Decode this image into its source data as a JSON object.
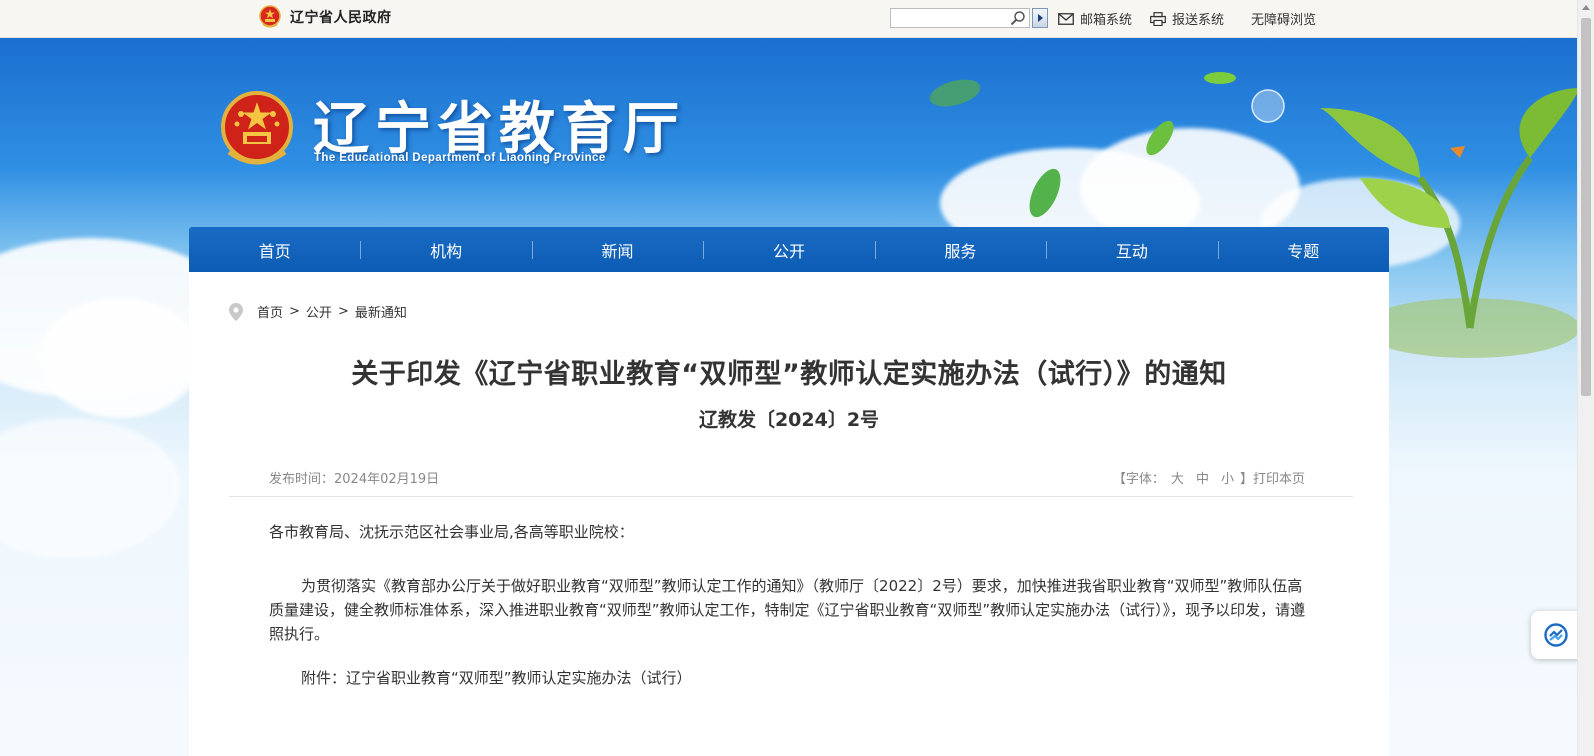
{
  "topbar": {
    "gov_name": "辽宁省人民政府",
    "search": {
      "placeholder": ""
    },
    "links": [
      {
        "label": "邮箱系统",
        "icon": "mail-icon"
      },
      {
        "label": "报送系统",
        "icon": "printer-icon"
      },
      {
        "label": "无障碍浏览"
      }
    ]
  },
  "banner": {
    "title": "辽宁省教育厅",
    "subtitle": "The Educational Department of Liaoning Province"
  },
  "nav": {
    "items": [
      "首页",
      "机构",
      "新闻",
      "公开",
      "服务",
      "互动",
      "专题"
    ]
  },
  "breadcrumb": {
    "items": [
      "首页",
      "公开",
      "最新通知"
    ],
    "separator": ">"
  },
  "article": {
    "title": "关于印发《辽宁省职业教育“双师型”教师认定实施办法（试行）》的通知",
    "doc_number": "辽教发〔2024〕2号",
    "publish": "发布时间：2024年02月19日",
    "font_label_open": "【字体：",
    "font_sizes": [
      "大",
      "中",
      "小"
    ],
    "font_label_close": "】",
    "print": "打印本页",
    "greeting": "各市教育局、沈抚示范区社会事业局,各高等职业院校：",
    "body": "为贯彻落实《教育部办公厅关于做好职业教育“双师型”教师认定工作的通知》（教师厅〔2022〕2号）要求，加快推进我省职业教育“双师型”教师队伍高质量建设，健全教师标准体系，深入推进职业教育“双师型”教师认定工作，特制定《辽宁省职业教育“双师型”教师认定实施办法（试行）》，现予以印发，请遵照执行。",
    "attachment": "附件：辽宁省职业教育“双师型”教师认定实施办法（试行）"
  },
  "colors": {
    "nav": "#0f60b8",
    "banner_top": "#1b6fcf",
    "text": "#333333",
    "meta": "#888888"
  }
}
